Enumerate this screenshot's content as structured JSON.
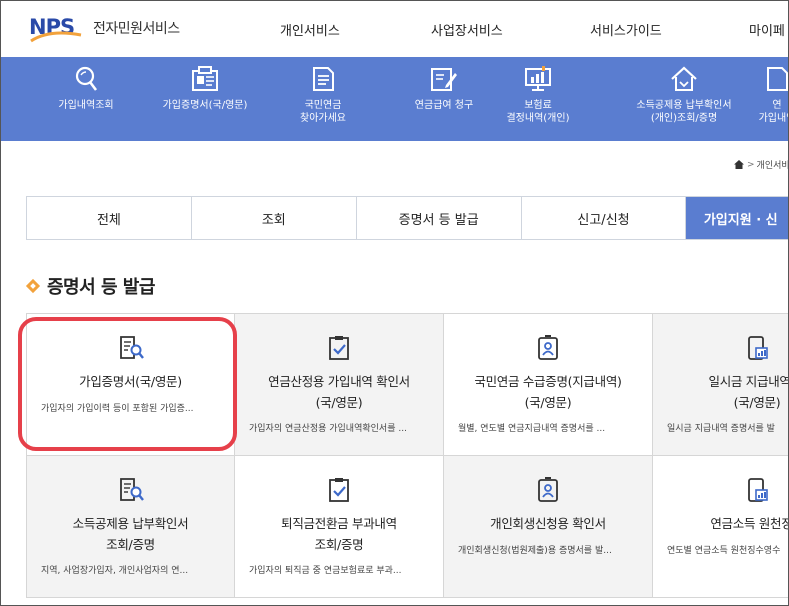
{
  "header": {
    "logo_text": "NPS",
    "service_name": "전자민원서비스",
    "nav": [
      "개인서비스",
      "사업장서비스",
      "서비스가이드",
      "마이페"
    ]
  },
  "quick_menu": [
    {
      "icon": "search-icon",
      "label1": "가입내역조회",
      "label2": ""
    },
    {
      "icon": "id-card-icon",
      "label1": "가입증명서(국/영문)",
      "label2": ""
    },
    {
      "icon": "document-icon",
      "label1": "국민연금",
      "label2": "찾아가세요"
    },
    {
      "icon": "edit-document-icon",
      "label1": "연금급여 청구",
      "label2": ""
    },
    {
      "icon": "monitor-chart-icon",
      "label1": "보험료",
      "label2": "결정내역(개인)"
    },
    {
      "icon": "house-icon",
      "label1": "소득공제용 납부확인서",
      "label2": "(개인)조회/증명"
    },
    {
      "icon": "document-icon",
      "label1": "연",
      "label2": "가입내역"
    }
  ],
  "breadcrumb": "개인서비",
  "tabs": [
    "전체",
    "조회",
    "증명서 등 발급",
    "신고/신청",
    "가입지원 · 신"
  ],
  "section_title": "증명서 등 발급",
  "cards": [
    {
      "icon": "document-search-icon",
      "title1": "가입증명서(국/영문)",
      "title2": "",
      "desc": "가입자의 가입이력 등이 포함된 가입증..."
    },
    {
      "icon": "clipboard-check-icon",
      "title1": "연금산정용 가입내역 확인서",
      "title2": "(국/영문)",
      "desc": "가입자의 연금산정용 가입내역확인서를 ..."
    },
    {
      "icon": "badge-person-icon",
      "title1": "국민연금 수급증명(지급내역)",
      "title2": "(국/영문)",
      "desc": "월별, 연도별 연금지급내역 증명서를 ..."
    },
    {
      "icon": "phone-chart-icon",
      "title1": "일시금 지급내역 증",
      "title2": "(국/영문)",
      "desc": "일시금 지급내역 증명서를 발"
    },
    {
      "icon": "document-search-icon",
      "title1": "소득공제용 납부확인서",
      "title2": "조회/증명",
      "desc": "지역, 사업장가입자, 개인사업자의 연..."
    },
    {
      "icon": "clipboard-check-icon",
      "title1": "퇴직금전환금 부과내역",
      "title2": "조회/증명",
      "desc": "가입자의 퇴직금 중 연금보험료로 부과..."
    },
    {
      "icon": "badge-person-icon",
      "title1": "개인회생신청용 확인서",
      "title2": "",
      "desc": "개인회생신청(법원제출)용 증명서를 발..."
    },
    {
      "icon": "phone-chart-icon",
      "title1": "연금소득 원천징수",
      "title2": "",
      "desc": "연도별 연금소득 원천징수영수"
    }
  ],
  "colors": {
    "brand_blue": "#5a7dd0",
    "logo_blue": "#2a4aa8",
    "logo_orange": "#f2a23c",
    "highlight": "#e6404a"
  }
}
